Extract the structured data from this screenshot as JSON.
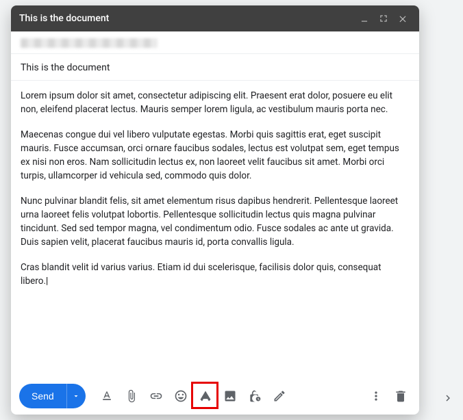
{
  "window": {
    "title": "This is the document"
  },
  "compose": {
    "subject": "This is the document",
    "body": {
      "p1": "Lorem ipsum dolor sit amet, consectetur adipiscing elit. Praesent erat dolor, posuere eu elit non, eleifend placerat lectus. Mauris semper lorem ligula, ac vestibulum mauris porta nec.",
      "p2": "Maecenas congue dui vel libero vulputate egestas. Morbi quis sagittis erat, eget suscipit mauris. Fusce accumsan, orci ornare faucibus sodales, lectus est volutpat sem, eget tempus ex nisi non eros. Nam sollicitudin lectus ex, non laoreet velit faucibus sit amet. Morbi orci turpis, ullamcorper id vehicula sed, commodo quis dolor.",
      "p3": "Nunc pulvinar blandit felis, sit amet elementum risus dapibus hendrerit. Pellentesque laoreet urna laoreet felis volutpat lobortis. Pellentesque sollicitudin lectus quis magna pulvinar tincidunt. Sed sed tempor magna, vel condimentum odio. Fusce sodales ac ante ut gravida. Duis sapien velit, placerat faucibus mauris id, porta convallis ligula.",
      "p4": "Cras blandit velit id varius varius. Etiam id dui scelerisque, facilisis dolor quis, consequat libero."
    }
  },
  "toolbar": {
    "send_label": "Send"
  }
}
